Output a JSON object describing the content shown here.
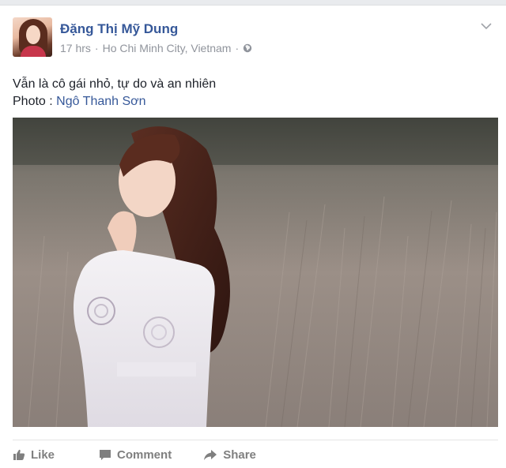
{
  "post": {
    "author": "Đặng Thị Mỹ Dung",
    "time": "17 hrs",
    "separator1": "·",
    "location": "Ho Chi Minh City, Vietnam",
    "separator2": "·",
    "privacy_icon": "globe-icon",
    "menu_icon": "chevron-down-icon",
    "message_line1": "Vẫn là cô gái nhỏ, tự do và an nhiên",
    "message_line2_prefix": "Photo : ",
    "message_line2_link": "Ngô Thanh Sơn",
    "photo_subject": "photo"
  },
  "actions": {
    "like_label": "Like",
    "comment_label": "Comment",
    "share_label": "Share",
    "like_icon": "thumbs-up-icon",
    "comment_icon": "speech-bubble-icon",
    "share_icon": "share-arrow-icon"
  },
  "colors": {
    "author": "#365899",
    "meta": "#90949c",
    "text": "#1d2129",
    "action": "#7f7f7f"
  }
}
